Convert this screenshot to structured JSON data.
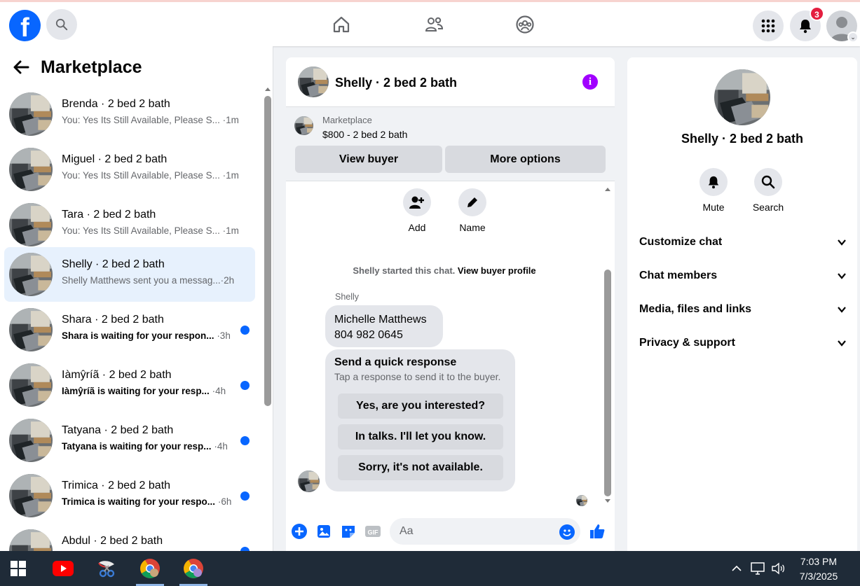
{
  "app": {
    "logo_letter": "f",
    "notifications_count": "3"
  },
  "sidebar": {
    "title": "Marketplace",
    "conversations": [
      {
        "name": "Brenda · 2 bed 2 bath",
        "snippet": "You: Yes Its Still Available, Please S...",
        "time": "·1m",
        "unread": false
      },
      {
        "name": "Miguel · 2 bed 2 bath",
        "snippet": "You: Yes Its Still Available, Please S...",
        "time": "·1m",
        "unread": false
      },
      {
        "name": "Tara · 2 bed 2 bath",
        "snippet": "You: Yes Its Still Available, Please S...",
        "time": "·1m",
        "unread": false
      },
      {
        "name": "Shelly · 2 bed 2 bath",
        "snippet": "Shelly Matthews sent you a messag...",
        "time": "·2h",
        "unread": false,
        "active": true
      },
      {
        "name": "Shara · 2 bed 2 bath",
        "snippet": "Shara is waiting for your respon...",
        "time": "·3h",
        "unread": true
      },
      {
        "name": "Iàmŷríã · 2 bed 2 bath",
        "snippet": "Iàmŷríã is waiting for your resp...",
        "time": "·4h",
        "unread": true
      },
      {
        "name": "Tatyana · 2 bed 2 bath",
        "snippet": "Tatyana is waiting for your resp...",
        "time": "·4h",
        "unread": true
      },
      {
        "name": "Trimica · 2 bed 2 bath",
        "snippet": "Trimica is waiting for your respo...",
        "time": "·6h",
        "unread": true
      },
      {
        "name": "Abdul · 2 bed 2 bath",
        "snippet": "",
        "time": "",
        "unread": true
      }
    ]
  },
  "chat": {
    "title": "Shelly · 2 bed 2 bath",
    "listing_category": "Marketplace",
    "listing_price": "$800 - 2 bed 2 bath",
    "view_buyer": "View buyer",
    "more_options": "More options",
    "add_label": "Add",
    "name_label": "Name",
    "system_text": "Shelly started this chat.",
    "system_link": "View buyer profile",
    "sender": "Shelly",
    "message_line1": "Michelle Matthews",
    "message_line2": "804 982 0645",
    "quick_title": "Send a quick response",
    "quick_subtitle": "Tap a response to send it to the buyer.",
    "quick_responses": [
      "Yes, are you interested?",
      "In talks. I'll let you know.",
      "Sorry, it's not available."
    ],
    "input_placeholder": "Aa"
  },
  "details": {
    "name": "Shelly · 2 bed 2 bath",
    "mute_label": "Mute",
    "search_label": "Search",
    "sections": [
      "Customize chat",
      "Chat members",
      "Media, files and links",
      "Privacy & support"
    ]
  },
  "taskbar": {
    "time": "7:03 PM",
    "date": "7/3/2025"
  },
  "colors": {
    "brand": "#0866ff",
    "active_bg": "#e7f1fd",
    "info": "#a100ff",
    "badge": "#e41e3f"
  }
}
